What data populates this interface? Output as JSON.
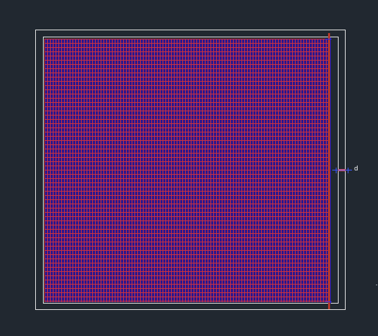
{
  "drawing": {
    "dimension_label": "d",
    "background_color": "#212830",
    "frame_color": "#e6e6e6",
    "grid_fill_color": "#2a1696",
    "grid_line_color": "#d8333f",
    "edge_bar_color": "#b33a2c",
    "dimension_color": "#3a5cff"
  }
}
